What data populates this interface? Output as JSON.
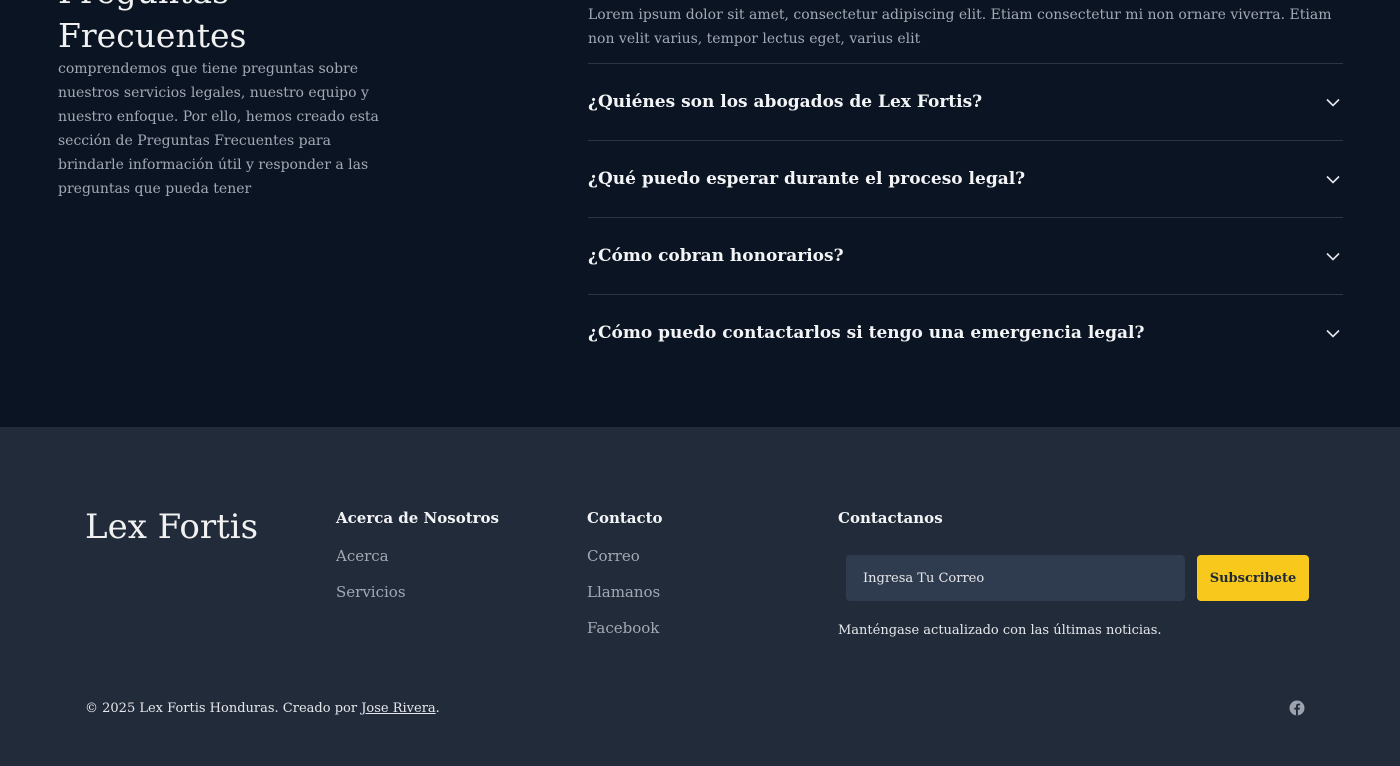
{
  "faq": {
    "title_line1": "Preguntas",
    "title_line2": "Frecuentes",
    "description": "comprendemos que tiene preguntas sobre nuestros servicios legales, nuestro equipo y nuestro enfoque. Por ello, hemos creado esta sección de Preguntas Frecuentes para brindarle información útil y responder a las preguntas que pueda tener",
    "intro": "Lorem ipsum dolor sit amet, consectetur adipiscing elit. Etiam consectetur mi non ornare viverra. Etiam non velit varius, tempor lectus eget, varius elit",
    "questions": [
      "¿Quiénes son los abogados de Lex Fortis?",
      "¿Qué puedo esperar durante el proceso legal?",
      "¿Cómo cobran honorarios?",
      "¿Cómo puedo contactarlos si tengo una emergencia legal?"
    ]
  },
  "footer": {
    "brand": "Lex Fortis",
    "about": {
      "heading": "Acerca de Nosotros",
      "links": [
        "Acerca",
        "Servicios"
      ]
    },
    "contact": {
      "heading": "Contacto",
      "links": [
        "Correo",
        "Llamanos",
        "Facebook"
      ]
    },
    "subscribe": {
      "heading": "Contactanos",
      "placeholder": "Ingresa Tu Correo",
      "button": "Subscribete",
      "note": "Manténgase actualizado con las últimas noticias."
    },
    "copyright_prefix": "© 2025 Lex Fortis Honduras. Creado por ",
    "author": "Jose Rivera",
    "copyright_suffix": ".",
    "social_icon": "facebook-icon"
  },
  "colors": {
    "accent": "#f8c91c",
    "faq_bg": "#0b1423",
    "footer_bg": "#222b3a"
  }
}
